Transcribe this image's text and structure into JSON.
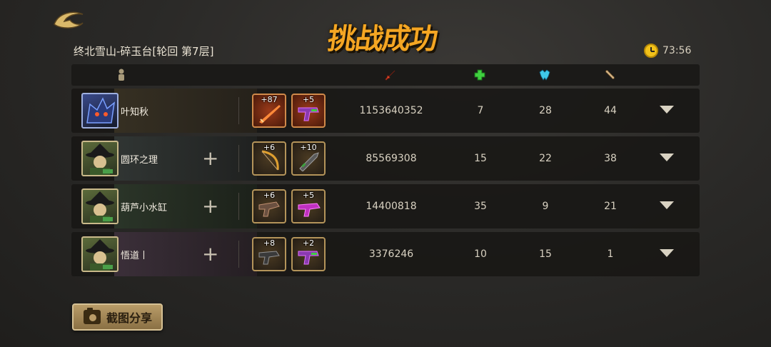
{
  "header": {
    "title": "挑战成功",
    "stage": "终北雪山-碎玉台[轮回 第7层]",
    "timer": "73:56"
  },
  "columns": {
    "player_icon": "person-icon",
    "damage_icon": "sword-icon",
    "heal_icon": "cross-icon",
    "tank_icon": "shield-beast-icon",
    "kills_icon": "bone-icon"
  },
  "players": [
    {
      "name": "叶知秋",
      "items": [
        {
          "level": "+87"
        },
        {
          "level": "+5"
        }
      ],
      "damage": "1153640352",
      "heal": "7",
      "tank": "28",
      "kills": "44"
    },
    {
      "name": "圆环之理",
      "items": [
        {
          "level": "+6"
        },
        {
          "level": "+10"
        }
      ],
      "damage": "85569308",
      "heal": "15",
      "tank": "22",
      "kills": "38"
    },
    {
      "name": "葫芦小水缸",
      "items": [
        {
          "level": "+6"
        },
        {
          "level": "+5"
        }
      ],
      "damage": "14400818",
      "heal": "35",
      "tank": "9",
      "kills": "21"
    },
    {
      "name": "悟道丨",
      "items": [
        {
          "level": "+8"
        },
        {
          "level": "+2"
        }
      ],
      "damage": "3376246",
      "heal": "10",
      "tank": "15",
      "kills": "1"
    }
  ],
  "share": {
    "label": "截图分享"
  },
  "colors": {
    "accent": "#f5a623",
    "damage": "#d9462a",
    "heal": "#3fd03f",
    "tank": "#3fc8e8",
    "kills": "#d8b88a"
  }
}
